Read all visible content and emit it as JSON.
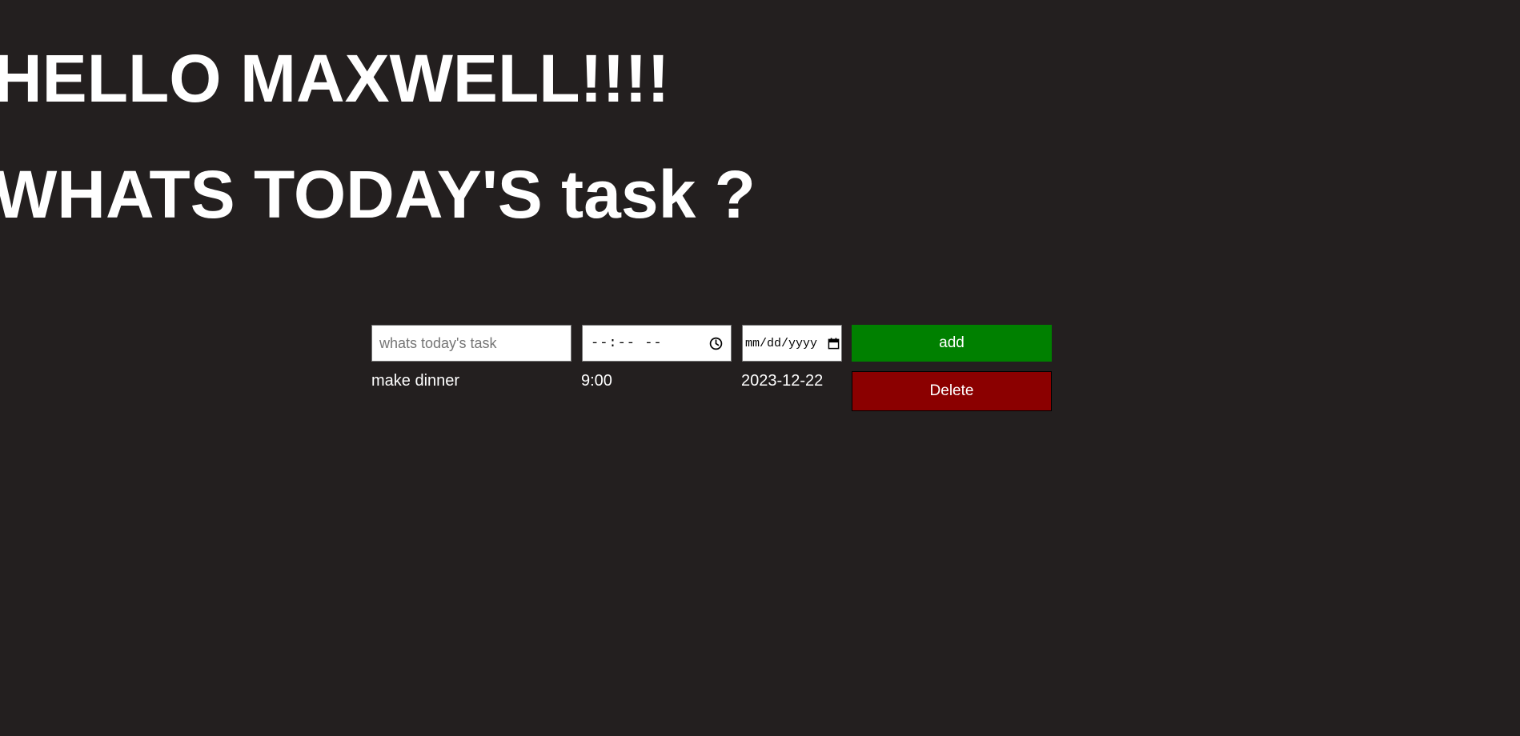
{
  "header": {
    "greeting": "HELLO MAXWELL!!!!",
    "question": "WHATS TODAY'S task ?"
  },
  "form": {
    "task_placeholder": "whats today's task",
    "task_value": "",
    "time_placeholder": "--:-- --",
    "date_placeholder": "mm/dd/yyyy",
    "add_label": "add"
  },
  "tasks": [
    {
      "name": "make dinner",
      "time": "9:00",
      "date": "2023-12-22",
      "delete_label": "Delete"
    }
  ],
  "icons": {
    "time_icon": "clock-icon",
    "date_icon": "calendar-icon"
  },
  "colors": {
    "background": "#231f1f",
    "add_button": "#008000",
    "delete_button": "#8b0000",
    "text": "#ffffff"
  }
}
